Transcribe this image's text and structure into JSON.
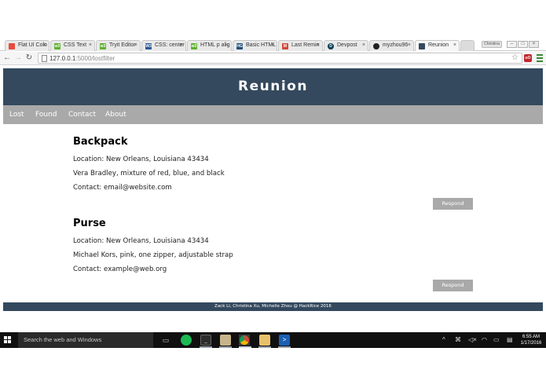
{
  "browser": {
    "tabs": [
      {
        "label": "Flat UI Colo",
        "fav_color": "#e74c3c",
        "fav_glyph": ""
      },
      {
        "label": "CSS Text",
        "fav_color": "#5fb02e",
        "fav_glyph": "w3"
      },
      {
        "label": "Tryit Editor",
        "fav_color": "#5fb02e",
        "fav_glyph": "w3"
      },
      {
        "label": "CSS: center",
        "fav_color": "#2b5797",
        "fav_glyph": "W3"
      },
      {
        "label": "HTML p alig",
        "fav_color": "#5fb02e",
        "fav_glyph": "w3"
      },
      {
        "label": "Basic HTML",
        "fav_color": "#1f4e79",
        "fav_glyph": "HG"
      },
      {
        "label": "Last Remin",
        "fav_color": "#d44638",
        "fav_glyph": "M"
      },
      {
        "label": "Devpost",
        "fav_color": "#003e54",
        "fav_glyph": "D"
      },
      {
        "label": "myzhou96",
        "fav_color": "#222222",
        "fav_glyph": "●"
      },
      {
        "label": "Reunion",
        "fav_color": "#34495e",
        "fav_glyph": "▪"
      }
    ],
    "profile_label": "Christina",
    "url_host": "127.0.0.1",
    "url_path": ":5000/lostfilter",
    "ext_label": "uO"
  },
  "site": {
    "title": "Reunion",
    "nav": [
      "Lost",
      "Found",
      "Contact",
      "About"
    ],
    "items": [
      {
        "title": "Backpack",
        "location": "Location: New Orleans, Louisiana 43434",
        "description": "Vera Bradley, mixture of red, blue, and black",
        "contact": "Contact: email@website.com",
        "button": "Respond"
      },
      {
        "title": "Purse",
        "location": "Location: New Orleans, Louisiana 43434",
        "description": "Michael Kors, pink, one zipper, adjustable strap",
        "contact": "Contact: example@web.org",
        "button": "Respond"
      }
    ],
    "footer": "Zack Li, Christina Xu, Michelle Zhou @ HackRice 2016"
  },
  "taskbar": {
    "search_placeholder": "Search the web and Windows",
    "time": "6:55 AM",
    "date": "1/17/2016"
  },
  "colors": {
    "header": "#34495e",
    "nav": "#a9a9a9",
    "button": "#a9a9a9"
  }
}
